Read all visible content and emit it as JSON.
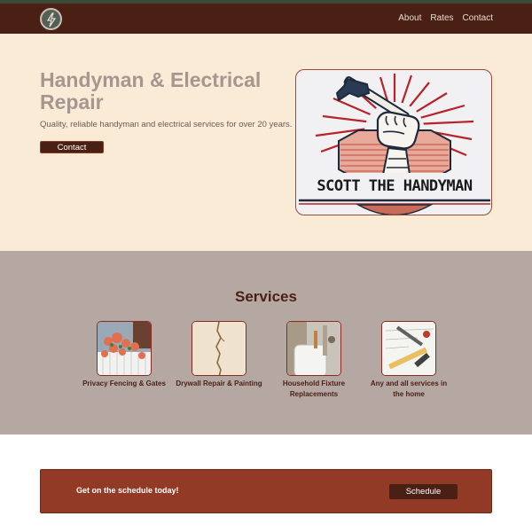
{
  "nav": {
    "logo_icon": "lightning-bolt-icon",
    "links": [
      "About",
      "Rates",
      "Contact"
    ]
  },
  "hero": {
    "title": "Handyman & Electrical Repair",
    "subtitle": "Quality, reliable handyman and electrical services for over 20 years.",
    "button_label": "Contact",
    "logo_text": "SCOTT THE HANDYMAN"
  },
  "services": {
    "title": "Services",
    "items": [
      {
        "label": "Privacy Fencing & Gates",
        "image": "fence-flowers-photo"
      },
      {
        "label": "Drywall Repair & Painting",
        "image": "drywall-crack-photo"
      },
      {
        "label": "Household Fixture Replacements",
        "image": "water-heater-photo"
      },
      {
        "label": "Any and all services in the home",
        "image": "tools-photo"
      }
    ]
  },
  "cta": {
    "text": "Get on the schedule today!",
    "button_label": "Schedule"
  },
  "colors": {
    "nav_bg": "#4a1f14",
    "hero_bg": "#faebd7",
    "services_bg": "#b5a8a2",
    "cta_bg": "#923a25",
    "accent": "#4a1f14"
  }
}
